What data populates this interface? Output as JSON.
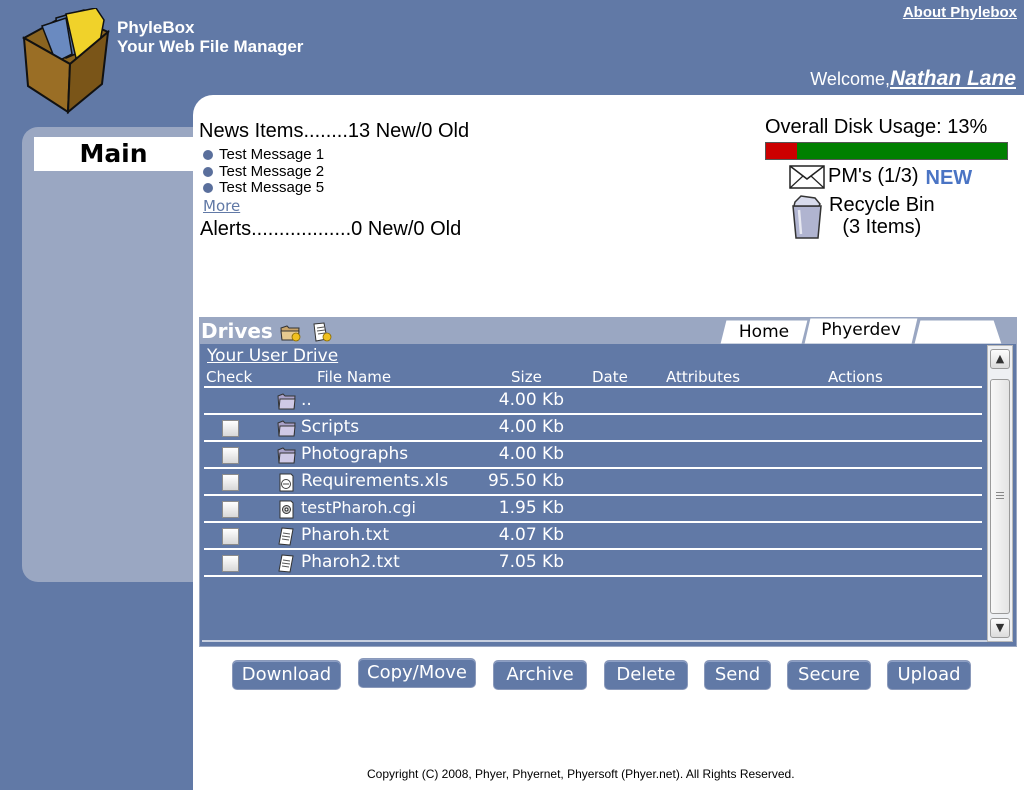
{
  "header": {
    "app_name": "PhyleBox",
    "tagline": "Your Web File Manager",
    "about_link": "About Phylebox",
    "welcome_prefix": "Welcome,",
    "user_name": "Nathan Lane",
    "logo_icon": "file-box-icon"
  },
  "sidebar": {
    "main_label": "Main"
  },
  "news": {
    "title": "News Items........13 New/0 Old",
    "items": [
      "Test Message 1",
      "Test Message 2",
      "Test Message 5"
    ],
    "more_label": "More",
    "alerts": "Alerts..................0 New/0 Old"
  },
  "status": {
    "disk_label": "Overall Disk Usage: 13%",
    "disk_usage_fraction": 0.13,
    "disk_used_color": "#cc0000",
    "disk_free_color": "#008000",
    "pm_label": "PM's (1/3)",
    "pm_new": "NEW",
    "pm_new_color": "#4a74c4",
    "pm_icon": "envelope-icon",
    "recycle_label": "Recycle Bin",
    "recycle_count": "(3 Items)",
    "recycle_icon": "recycle-bin-icon"
  },
  "drives": {
    "title": "Drives",
    "tabs": [
      "Home",
      "Phyerdev"
    ],
    "drive_link": "Your User Drive",
    "columns": [
      "Check",
      "File Name",
      "Size",
      "Date",
      "Attributes",
      "Actions"
    ],
    "files": [
      {
        "name": "..",
        "size": "4.00 Kb",
        "icon": "folder-icon",
        "checkbox": false
      },
      {
        "name": "Scripts",
        "size": "4.00 Kb",
        "icon": "folder-icon",
        "checkbox": true
      },
      {
        "name": "Photographs",
        "size": "4.00 Kb",
        "icon": "folder-icon",
        "checkbox": true
      },
      {
        "name": "Requirements.xls",
        "size": "95.50 Kb",
        "icon": "spreadsheet-file-icon",
        "checkbox": true
      },
      {
        "name": "testPharoh.cgi",
        "size": "1.95 Kb",
        "icon": "script-file-icon",
        "checkbox": true
      },
      {
        "name": "Pharoh.txt",
        "size": "4.07 Kb",
        "icon": "text-file-icon",
        "checkbox": true
      },
      {
        "name": "Pharoh2.txt",
        "size": "7.05 Kb",
        "icon": "text-file-icon",
        "checkbox": true
      }
    ]
  },
  "actions": [
    "Download",
    "Copy/Move",
    "Archive",
    "Delete",
    "Send",
    "Secure",
    "Upload"
  ],
  "footer": {
    "copyright": "Copyright (C) 2008, Phyer, Phyernet, Phyersoft (Phyer.net). All Rights Reserved."
  }
}
